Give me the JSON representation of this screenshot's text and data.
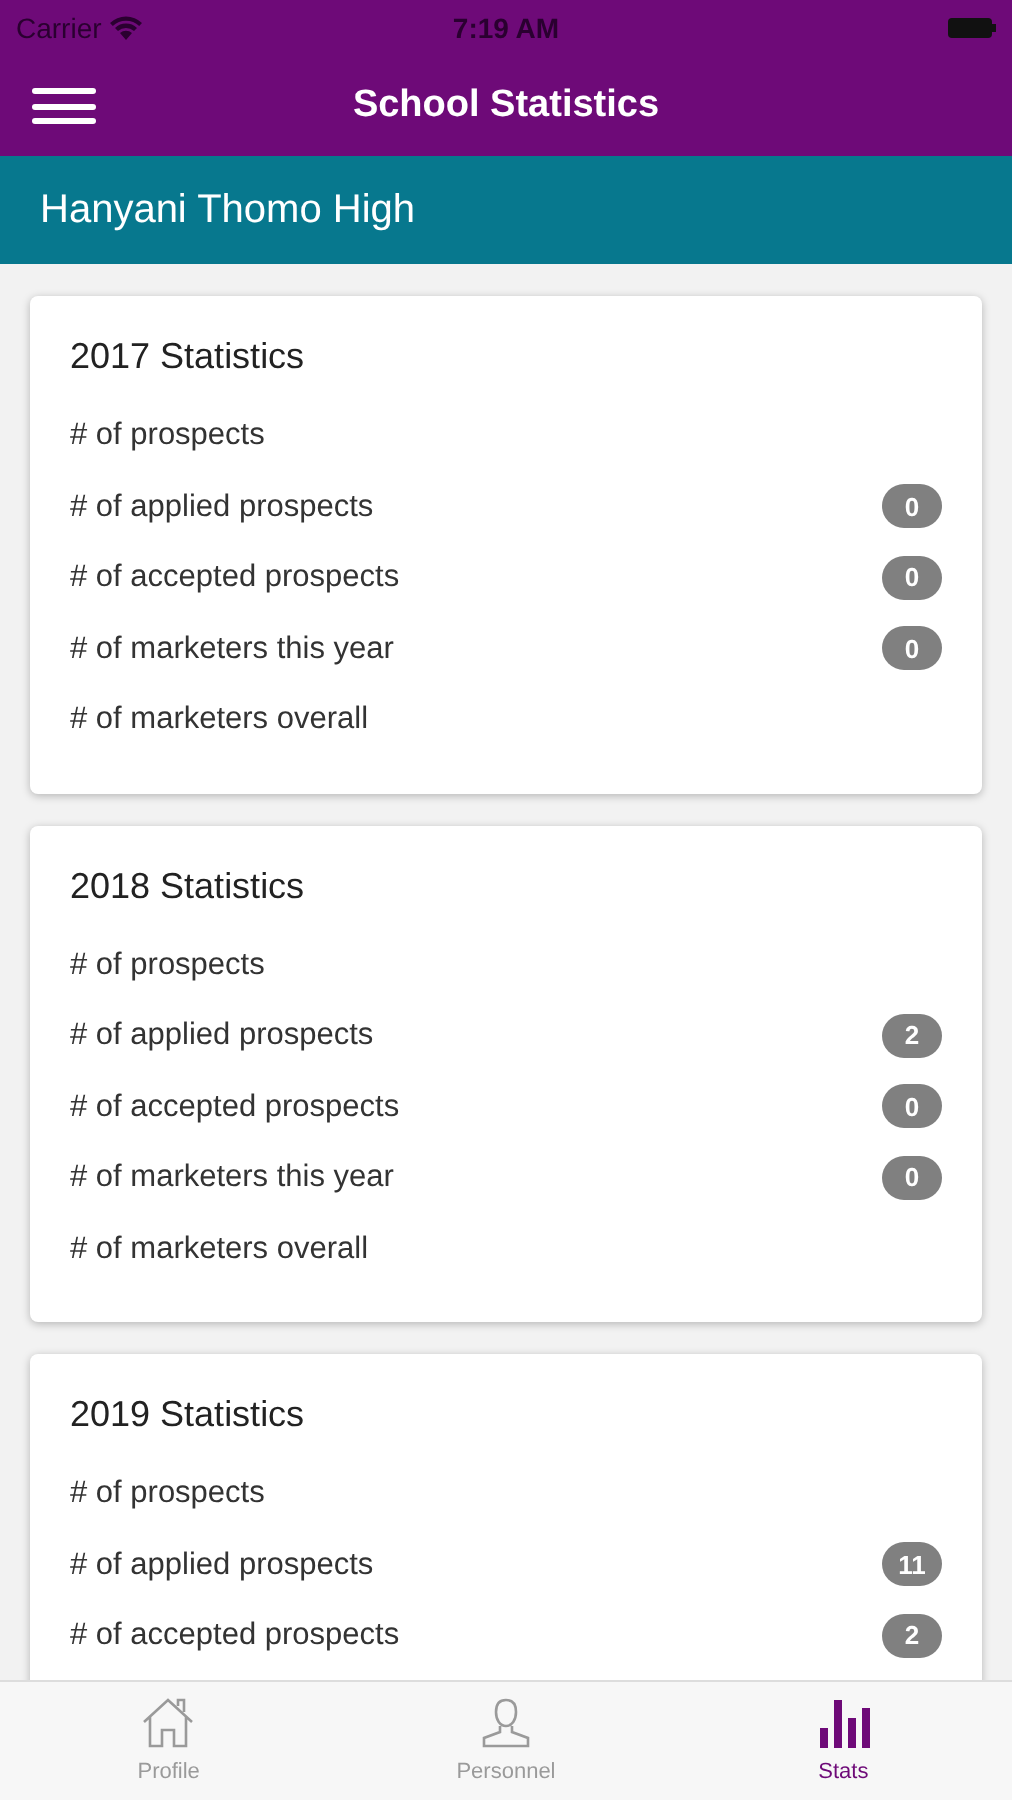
{
  "status_bar": {
    "carrier": "Carrier",
    "time": "7:19 AM"
  },
  "nav": {
    "title": "School Statistics"
  },
  "school": {
    "name": "Hanyani Thomo High"
  },
  "cards": [
    {
      "title": "2017 Statistics",
      "rows": [
        {
          "label": "# of prospects"
        },
        {
          "label": "# of applied prospects",
          "badge": "0"
        },
        {
          "label": "# of accepted prospects",
          "badge": "0"
        },
        {
          "label": "# of marketers this year",
          "badge": "0"
        },
        {
          "label": "# of marketers overall"
        }
      ]
    },
    {
      "title": "2018 Statistics",
      "rows": [
        {
          "label": "# of prospects"
        },
        {
          "label": "# of applied prospects",
          "badge": "2"
        },
        {
          "label": "# of accepted prospects",
          "badge": "0"
        },
        {
          "label": "# of marketers this year",
          "badge": "0"
        },
        {
          "label": "# of marketers overall"
        }
      ]
    },
    {
      "title": "2019 Statistics",
      "rows": [
        {
          "label": "# of prospects"
        },
        {
          "label": "# of applied prospects",
          "badge": "11"
        },
        {
          "label": "# of accepted prospects",
          "badge": "2"
        }
      ]
    }
  ],
  "tabs": [
    {
      "label": "Profile",
      "kind": "home",
      "selected": false
    },
    {
      "label": "Personnel",
      "kind": "person",
      "selected": false
    },
    {
      "label": "Stats",
      "kind": "stats",
      "selected": true
    }
  ]
}
